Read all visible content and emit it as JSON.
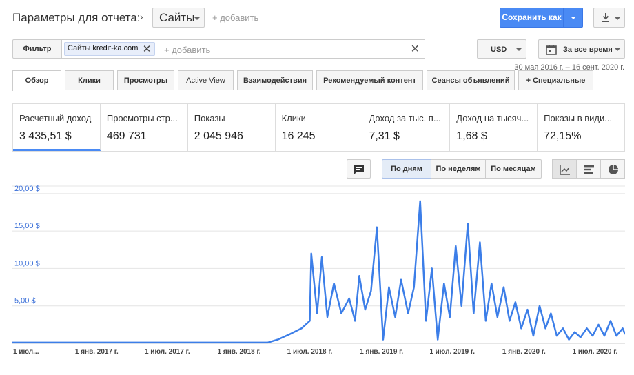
{
  "header": {
    "title": "Параметры для отчета:",
    "dimension": "Сайты",
    "add_dimension": "+ добавить",
    "save_label": "Сохранить как"
  },
  "filter": {
    "button_label": "Фильтр",
    "chip_prefix": "Сайты",
    "chip_value": "kredit-ka.com",
    "add_placeholder": "+ добавить"
  },
  "currency": "USD",
  "date": {
    "label": "За все время",
    "range": "30 мая 2016 г. – 16 сент. 2020 г."
  },
  "tabs": [
    {
      "label": "Обзор"
    },
    {
      "label": "Клики"
    },
    {
      "label": "Просмотры"
    },
    {
      "label": "Active View"
    },
    {
      "label": "Взаимодействия"
    },
    {
      "label": "Рекомендуемый контент"
    },
    {
      "label": "Сеансы объявлений"
    },
    {
      "label": "+ Специальные"
    }
  ],
  "metrics": [
    {
      "label": "Расчетный доход",
      "value": "3 435,51 $"
    },
    {
      "label": "Просмотры стр...",
      "value": "469 731"
    },
    {
      "label": "Показы",
      "value": "2 045 946"
    },
    {
      "label": "Клики",
      "value": "16 245"
    },
    {
      "label": "Доход за тыс. п...",
      "value": "7,31 $"
    },
    {
      "label": "Доход на тысяч...",
      "value": "1,68 $"
    },
    {
      "label": "Показы в види...",
      "value": "72,15%"
    }
  ],
  "periods": {
    "day": "По дням",
    "week": "По неделям",
    "month": "По месяцам",
    "selected": "По дням"
  },
  "icons": {
    "calendar": "calendar-icon",
    "download": "download-icon",
    "annotation": "comment-icon",
    "line_chart": "line-chart-icon",
    "bar_chart": "bar-chart-icon",
    "pie_chart": "pie-chart-icon"
  },
  "colors": {
    "accent": "#4a8af4",
    "line": "#3c7ee8",
    "axis_text": "#3a6fd8"
  },
  "chart_data": {
    "type": "line",
    "title": "",
    "ylabel": "",
    "y_ticks": [
      "5,00 $",
      "10,00 $",
      "15,00 $",
      "20,00 $"
    ],
    "y_tick_values": [
      5,
      10,
      15,
      20
    ],
    "ylim": [
      0,
      21
    ],
    "x_tick_labels": [
      "1 июл...",
      "1 янв. 2017 г.",
      "1 июл. 2017 г.",
      "1 янв. 2018 г.",
      "1 июл. 2018 г.",
      "1 янв. 2019 г.",
      "1 июл. 2019 г.",
      "1 янв. 2020 г.",
      "1 июл. 2020 г."
    ],
    "x_tick_dates": [
      "2016-07-01",
      "2017-01-01",
      "2017-07-01",
      "2018-01-01",
      "2018-07-01",
      "2019-01-01",
      "2019-07-01",
      "2020-01-01",
      "2020-07-01"
    ],
    "x_range": [
      "2016-05-30",
      "2020-09-16"
    ],
    "grid": true,
    "series": [
      {
        "color": "#3c7ee8",
        "points": [
          [
            "2016-05-30",
            0.1
          ],
          [
            "2017-06-01",
            0.1
          ],
          [
            "2018-03-15",
            0.1
          ],
          [
            "2018-04-10",
            0.5
          ],
          [
            "2018-05-10",
            1.2
          ],
          [
            "2018-06-10",
            2.0
          ],
          [
            "2018-07-01",
            3.0
          ],
          [
            "2018-07-05",
            12.0
          ],
          [
            "2018-07-20",
            4.0
          ],
          [
            "2018-08-01",
            11.5
          ],
          [
            "2018-08-15",
            3.5
          ],
          [
            "2018-09-01",
            8.0
          ],
          [
            "2018-09-20",
            4.0
          ],
          [
            "2018-10-10",
            6.0
          ],
          [
            "2018-10-25",
            3.0
          ],
          [
            "2018-11-05",
            9.0
          ],
          [
            "2018-11-20",
            4.5
          ],
          [
            "2018-12-05",
            7.0
          ],
          [
            "2018-12-20",
            15.5
          ],
          [
            "2019-01-05",
            0.5
          ],
          [
            "2019-01-20",
            7.5
          ],
          [
            "2019-02-05",
            3.5
          ],
          [
            "2019-02-20",
            8.5
          ],
          [
            "2019-03-10",
            4.0
          ],
          [
            "2019-03-25",
            7.5
          ],
          [
            "2019-04-10",
            19.0
          ],
          [
            "2019-04-25",
            3.0
          ],
          [
            "2019-05-10",
            10.0
          ],
          [
            "2019-05-25",
            0.5
          ],
          [
            "2019-06-10",
            8.0
          ],
          [
            "2019-06-25",
            3.5
          ],
          [
            "2019-07-10",
            13.0
          ],
          [
            "2019-07-25",
            5.0
          ],
          [
            "2019-08-10",
            16.0
          ],
          [
            "2019-08-25",
            4.0
          ],
          [
            "2019-09-10",
            13.5
          ],
          [
            "2019-09-25",
            3.0
          ],
          [
            "2019-10-10",
            8.0
          ],
          [
            "2019-10-25",
            3.5
          ],
          [
            "2019-11-10",
            7.5
          ],
          [
            "2019-11-25",
            3.0
          ],
          [
            "2019-12-10",
            5.5
          ],
          [
            "2019-12-25",
            2.0
          ],
          [
            "2020-01-10",
            4.5
          ],
          [
            "2020-01-25",
            1.0
          ],
          [
            "2020-02-10",
            5.0
          ],
          [
            "2020-02-25",
            2.0
          ],
          [
            "2020-03-10",
            4.0
          ],
          [
            "2020-03-25",
            1.0
          ],
          [
            "2020-04-10",
            2.0
          ],
          [
            "2020-04-25",
            0.5
          ],
          [
            "2020-05-10",
            1.5
          ],
          [
            "2020-05-25",
            0.8
          ],
          [
            "2020-06-10",
            2.0
          ],
          [
            "2020-06-25",
            1.0
          ],
          [
            "2020-07-10",
            2.5
          ],
          [
            "2020-07-25",
            1.0
          ],
          [
            "2020-08-10",
            3.0
          ],
          [
            "2020-08-25",
            1.0
          ],
          [
            "2020-09-10",
            2.0
          ],
          [
            "2020-09-16",
            1.2
          ]
        ]
      }
    ]
  }
}
